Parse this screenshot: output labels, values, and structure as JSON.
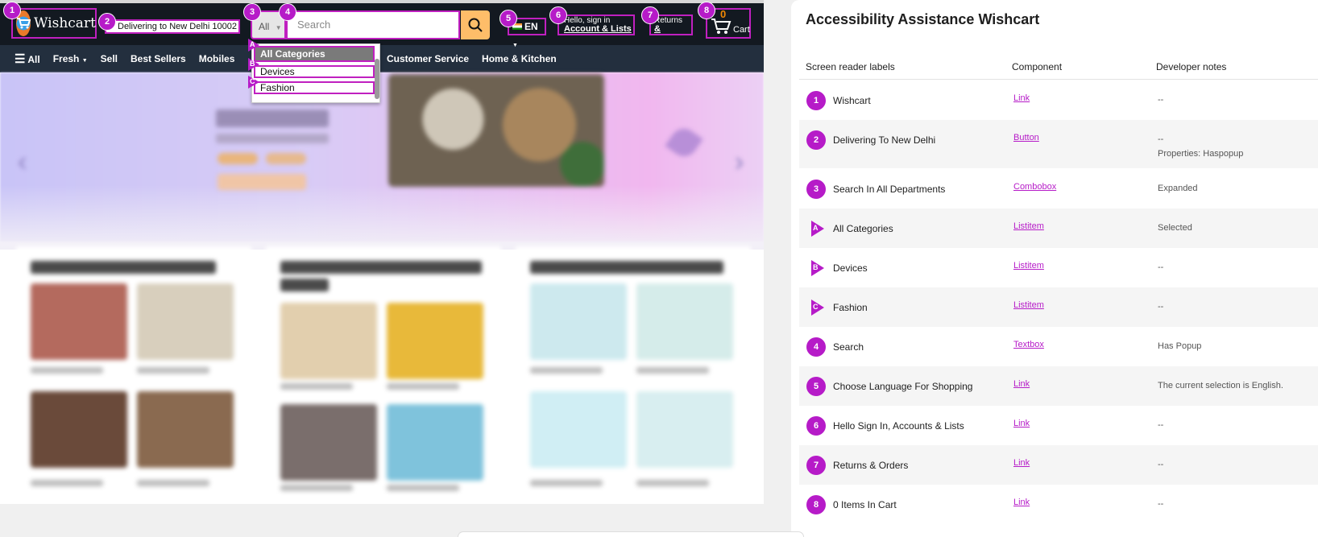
{
  "site": {
    "logo_text": "Wishcart",
    "delivering": "Delivering to New Delhi 10002",
    "search_category": "All",
    "search_placeholder": "Search",
    "language": "EN",
    "account_line1": "Hello, sign in",
    "account_line2": "Account & Lists",
    "returns_line1": "Returns",
    "returns_line2": "& Orders",
    "cart_count": "0",
    "cart_label": "Cart",
    "nav_items": [
      "All",
      "Fresh",
      "Sell",
      "Best Sellers",
      "Mobiles"
    ],
    "nav_items_right": [
      "Customer Service",
      "Home & Kitchen"
    ],
    "dropdown_items": [
      "All Categories",
      "Devices",
      "Fashion"
    ]
  },
  "markers": {
    "numbers": [
      "1",
      "2",
      "3",
      "4",
      "5",
      "6",
      "7",
      "8"
    ],
    "letters": [
      "A",
      "B",
      "C"
    ]
  },
  "panel": {
    "title": "Accessibility Assistance Wishcart",
    "columns": [
      "Screen reader labels",
      "Component",
      "Developer notes"
    ],
    "rows": [
      {
        "marker": "1",
        "label": "Wishcart",
        "component": "Link",
        "note": "--",
        "note2": ""
      },
      {
        "marker": "2",
        "label": "Delivering To New Delhi",
        "component": "Button",
        "note": "--",
        "note2": "Properties: Haspopup"
      },
      {
        "marker": "3",
        "label": "Search In All Departments",
        "component": "Combobox",
        "note": "Expanded",
        "note2": ""
      },
      {
        "marker": "A",
        "label": "All Categories",
        "component": "Listitem",
        "note": "Selected",
        "note2": ""
      },
      {
        "marker": "B",
        "label": "Devices",
        "component": "Listitem",
        "note": "--",
        "note2": ""
      },
      {
        "marker": "C",
        "label": "Fashion",
        "component": "Listitem",
        "note": "--",
        "note2": ""
      },
      {
        "marker": "4",
        "label": "Search",
        "component": "Textbox",
        "note": "Has Popup",
        "note2": ""
      },
      {
        "marker": "5",
        "label": "Choose Language For Shopping",
        "component": "Link",
        "note": "The current selection is English.",
        "note2": ""
      },
      {
        "marker": "6",
        "label": "Hello Sign In, Accounts & Lists",
        "component": "Link",
        "note": "--",
        "note2": ""
      },
      {
        "marker": "7",
        "label": "Returns & Orders",
        "component": "Link",
        "note": "--",
        "note2": ""
      },
      {
        "marker": "8",
        "label": "0 Items In Cart",
        "component": "Link",
        "note": "--",
        "note2": ""
      }
    ]
  },
  "colors": {
    "accent": "#b61bc8",
    "header_bg": "#131921",
    "nav_bg": "#232f3e",
    "search_button": "#febd69"
  }
}
